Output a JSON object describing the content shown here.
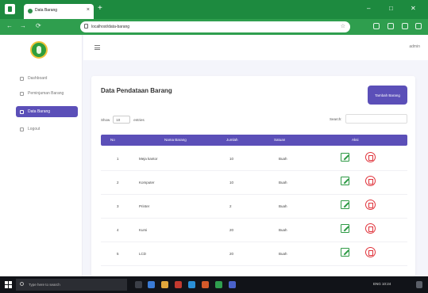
{
  "browser": {
    "tab_title": "Data Barang",
    "tab_close": "×",
    "new_tab": "+",
    "url": "localhost/data-barang",
    "back": "←",
    "forward": "→",
    "reload": "⟳",
    "star": "☆",
    "win_min": "–",
    "win_max": "□",
    "win_close": "✕"
  },
  "app": {
    "user_label": "admin",
    "sidebar": [
      {
        "label": "Dashboard"
      },
      {
        "label": "Peminjaman Barang"
      },
      {
        "label": "Data Barang"
      },
      {
        "label": "Logout"
      }
    ],
    "page_title": "Data Pendataan Barang",
    "add_button": "Tambah Barang",
    "show_label": "Show",
    "show_value": "10",
    "entries_label": "entries",
    "search_label": "Search:",
    "columns": {
      "no": "No",
      "name": "Nama Barang",
      "qty": "Jumlah",
      "unit": "Satuan",
      "action": "Aksi"
    },
    "rows": [
      {
        "no": "1",
        "name": "Meja kantor",
        "qty": "10",
        "unit": "Buah"
      },
      {
        "no": "2",
        "name": "Komputer",
        "qty": "10",
        "unit": "Buah"
      },
      {
        "no": "3",
        "name": "Printer",
        "qty": "2",
        "unit": "Buah"
      },
      {
        "no": "4",
        "name": "Kursi",
        "qty": "20",
        "unit": "Buah"
      },
      {
        "no": "5",
        "name": "LCD",
        "qty": "20",
        "unit": "Buah"
      }
    ]
  },
  "taskbar": {
    "search_placeholder": "Type here to search",
    "tray_text": "ENG 10:24"
  },
  "colors": {
    "chrome_green": "#1d8a3f",
    "accent_purple": "#5b4fb8",
    "edit_green": "#2e9a45",
    "delete_red": "#e0333b"
  }
}
